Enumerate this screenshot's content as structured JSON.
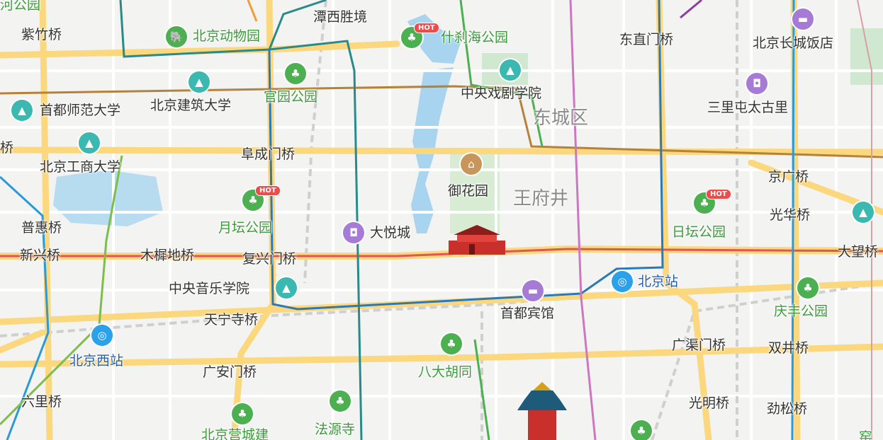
{
  "map": {
    "district_labels": [
      "东城区",
      "王府井"
    ],
    "bridges": [
      "紫竹桥",
      "阜成门桥",
      "复兴门桥",
      "木樨地桥",
      "新兴桥",
      "普惠桥",
      "天宁寺桥",
      "广安门桥",
      "六里桥",
      "东直门桥",
      "京广桥",
      "光华桥",
      "大望桥",
      "广渠门桥",
      "双井桥",
      "光明桥",
      "劲松桥",
      "桥"
    ],
    "areas": [
      "潭西胜境",
      "首都宾馆"
    ],
    "pois": {
      "zoo": "北京动物园",
      "shichahai": "什刹海公园",
      "great_wall_hotel": "北京长城饭店",
      "drama_academy": "中央戏剧学院",
      "guanyuan_park": "官园公园",
      "jianzhu_univ": "北京建筑大学",
      "capital_normal": "首都师范大学",
      "sanlitun": "三里屯太古里",
      "gongshang_univ": "北京工商大学",
      "imperial_garden": "御花园",
      "yuetan_park": "月坛公园",
      "joy_city": "大悦城",
      "ritan_park": "日坛公园",
      "conservatory": "中央音乐学院",
      "beijing_station": "北京站",
      "qingfeng_park": "庆丰公园",
      "west_station": "北京西站",
      "badahutong": "八大胡同",
      "fayuansi": "法源寺",
      "daguan_partial": "北京营城建",
      "top_left_partial": "河公园",
      "right_partial": "窑"
    },
    "hot_badge": "HOT"
  }
}
